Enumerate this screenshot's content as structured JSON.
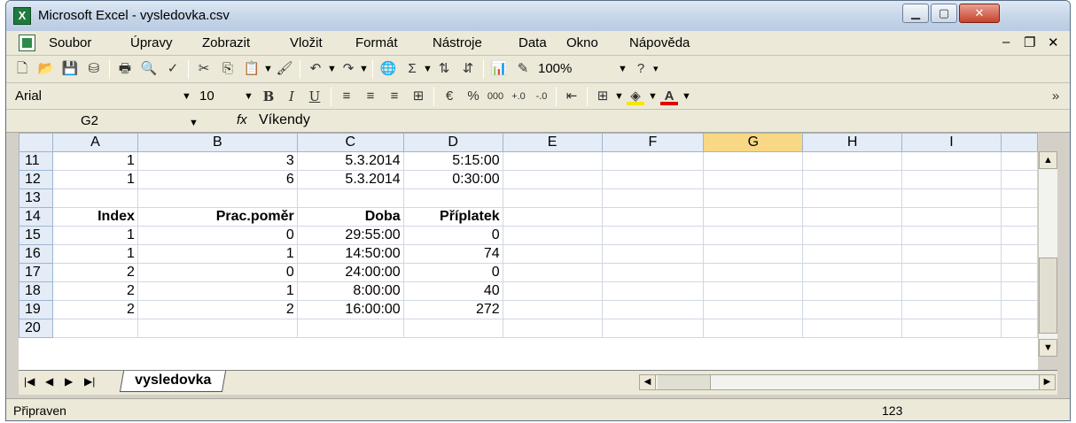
{
  "window": {
    "title": "Microsoft Excel - vysledovka.csv"
  },
  "menu": [
    "Soubor",
    "Úpravy",
    "Zobrazit",
    "Vložit",
    "Formát",
    "Nástroje",
    "Data",
    "Okno",
    "Nápověda"
  ],
  "toolbar": {
    "zoom": "100%"
  },
  "format_toolbar": {
    "font": "Arial",
    "size": "10"
  },
  "formula_bar": {
    "cell_ref": "G2",
    "fx": "fx",
    "value": "Víkendy"
  },
  "columns": [
    "A",
    "B",
    "C",
    "D",
    "E",
    "F",
    "G",
    "H",
    "I"
  ],
  "selected_column": "G",
  "rows": [
    {
      "n": "11",
      "cells": [
        "1",
        "3",
        "5.3.2014",
        "5:15:00",
        "",
        "",
        "",
        "",
        ""
      ]
    },
    {
      "n": "12",
      "cells": [
        "1",
        "6",
        "5.3.2014",
        "0:30:00",
        "",
        "",
        "",
        "",
        ""
      ]
    },
    {
      "n": "13",
      "cells": [
        "",
        "",
        "",
        "",
        "",
        "",
        "",
        "",
        ""
      ]
    },
    {
      "n": "14",
      "cells": [
        "Index",
        "Prac.poměr",
        "Doba",
        "Příplatek",
        "",
        "",
        "",
        "",
        ""
      ]
    },
    {
      "n": "15",
      "cells": [
        "1",
        "0",
        "29:55:00",
        "0",
        "",
        "",
        "",
        "",
        ""
      ]
    },
    {
      "n": "16",
      "cells": [
        "1",
        "1",
        "14:50:00",
        "74",
        "",
        "",
        "",
        "",
        ""
      ]
    },
    {
      "n": "17",
      "cells": [
        "2",
        "0",
        "24:00:00",
        "0",
        "",
        "",
        "",
        "",
        ""
      ]
    },
    {
      "n": "18",
      "cells": [
        "2",
        "1",
        "8:00:00",
        "40",
        "",
        "",
        "",
        "",
        ""
      ]
    },
    {
      "n": "19",
      "cells": [
        "2",
        "2",
        "16:00:00",
        "272",
        "",
        "",
        "",
        "",
        ""
      ]
    },
    {
      "n": "20",
      "cells": [
        "",
        "",
        "",
        "",
        "",
        "",
        "",
        "",
        ""
      ]
    }
  ],
  "sheet_tab": "vysledovka",
  "status": {
    "text": "Připraven",
    "number": "123"
  }
}
